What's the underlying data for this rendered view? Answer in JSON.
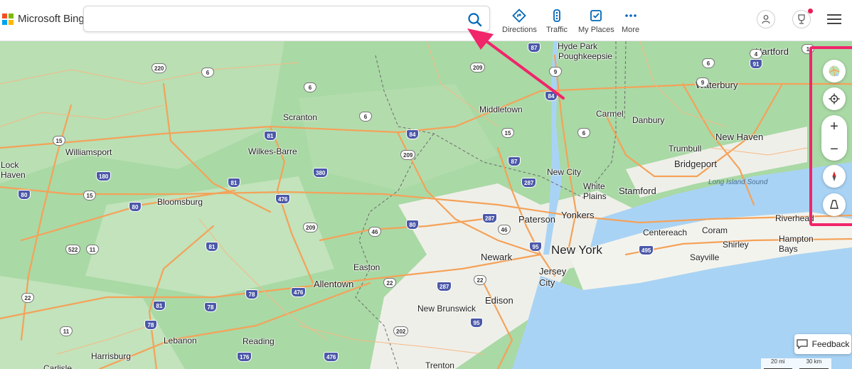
{
  "header": {
    "logo_text": "Microsoft Bing",
    "logo_colors": [
      "#f25022",
      "#7fba00",
      "#00a4ef",
      "#ffb900"
    ],
    "search": {
      "value": "",
      "placeholder": ""
    },
    "nav": [
      {
        "label": "Directions",
        "icon": "directions-icon"
      },
      {
        "label": "Traffic",
        "icon": "traffic-icon"
      },
      {
        "label": "My Places",
        "icon": "my-places-icon"
      },
      {
        "label": "More",
        "icon": "more-icon"
      }
    ],
    "accent": "#0067b8"
  },
  "map": {
    "colors": {
      "land": "#a9d9a5",
      "land_light": "#c7e6c0",
      "urban": "#f1f0ec",
      "water": "#a9d3f5",
      "road": "#f4a259",
      "state_line": "#6b6b6b"
    },
    "places": [
      "Hyde Park",
      "Poughkeepsie",
      "Hartford",
      "Scranton",
      "Middletown",
      "Waterbury",
      "Carmel",
      "Danbury",
      "Williamsport",
      "Wilkes-Barre",
      "New Haven",
      "Lock",
      "Haven",
      "Trumbull",
      "Bridgeport",
      "New City",
      "Long Island Sound",
      "White",
      "Plains",
      "Stamford",
      "Bloomsburg",
      "Yonkers",
      "Paterson",
      "Riverhead",
      "Centereach",
      "Coram",
      "Hampton",
      "Bays",
      "Shirley",
      "New York",
      "Newark",
      "Sayville",
      "Easton",
      "Jersey",
      "City",
      "Allentown",
      "Edison",
      "New Brunswick",
      "Lebanon",
      "Reading",
      "Harrisburg",
      "Carlisle",
      "Trenton"
    ],
    "shields": [
      "87",
      "220",
      "6",
      "209",
      "6",
      "6",
      "9",
      "84",
      "15",
      "81",
      "84",
      "380",
      "209",
      "180",
      "81",
      "6",
      "87",
      "476",
      "80",
      "287",
      "15",
      "80",
      "522",
      "11",
      "209",
      "46",
      "80",
      "81",
      "287",
      "46",
      "95",
      "495",
      "22",
      "78",
      "476",
      "81",
      "78",
      "22",
      "287",
      "22",
      "78",
      "95",
      "11",
      "202",
      "476",
      "176",
      "9",
      "4",
      "6",
      "91",
      "1",
      "15"
    ]
  },
  "controls": {
    "highlight_color": "#f0256a",
    "map_style_icon": "map-style-icon",
    "locate_icon": "locate-me-icon",
    "zoom_in": "+",
    "zoom_out": "−",
    "compass_icon": "compass-icon",
    "tilt_icon": "tilt-icon"
  },
  "feedback": {
    "label": "Feedback"
  },
  "scale": {
    "mi": "20 mi",
    "km": "30 km"
  }
}
